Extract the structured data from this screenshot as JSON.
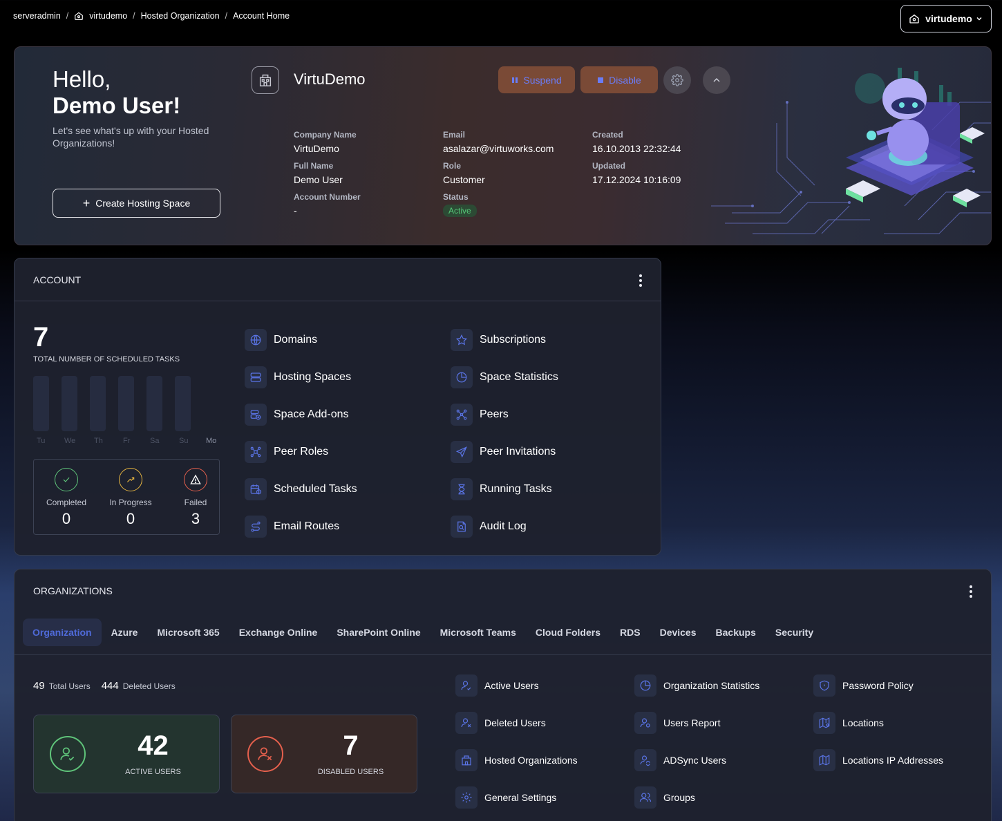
{
  "breadcrumb": {
    "items": [
      "serveradmin",
      "virtudemo",
      "Hosted Organization",
      "Account Home"
    ],
    "separator": "/"
  },
  "switcher": {
    "label": "virtudemo"
  },
  "hero": {
    "greeting_line1": "Hello,",
    "greeting_line2": "Demo User!",
    "subtitle": "Let's see what's up with your Hosted Organizations!",
    "create_button": "Create Hosting Space",
    "org_name": "VirtuDemo",
    "suspend_label": "Suspend",
    "disable_label": "Disable",
    "fields": {
      "company_name_label": "Company Name",
      "company_name": "VirtuDemo",
      "full_name_label": "Full Name",
      "full_name": "Demo User",
      "account_number_label": "Account Number",
      "account_number": "-",
      "email_label": "Email",
      "email": "asalazar@virtuworks.com",
      "role_label": "Role",
      "role": "Customer",
      "status_label": "Status",
      "status": "Active",
      "created_label": "Created",
      "created": "16.10.2013 22:32:44",
      "updated_label": "Updated",
      "updated": "17.12.2024 10:16:09"
    },
    "colors": {
      "button_bg": "#7a4a36",
      "button_text": "#6a7cf5",
      "status_green": "#55c978"
    }
  },
  "account": {
    "title": "ACCOUNT",
    "total_tasks": "7",
    "total_tasks_label": "TOTAL NUMBER OF SCHEDULED TASKS",
    "days": [
      "Tu",
      "We",
      "Th",
      "Fr",
      "Sa",
      "Su",
      "Mo"
    ],
    "stats": [
      {
        "label": "Completed",
        "value": "0",
        "icon": "check-icon",
        "color": "#5fc47a"
      },
      {
        "label": "In Progress",
        "value": "0",
        "icon": "trend-arrow-icon",
        "color": "#e3b341"
      },
      {
        "label": "Failed",
        "value": "3",
        "icon": "warning-icon",
        "color": "#e5604d"
      }
    ],
    "links": [
      {
        "label": "Domains",
        "icon": "globe-icon"
      },
      {
        "label": "Subscriptions",
        "icon": "star-icon"
      },
      {
        "label": "Hosting Spaces",
        "icon": "server-icon"
      },
      {
        "label": "Space Statistics",
        "icon": "pie-chart-icon"
      },
      {
        "label": "Space Add-ons",
        "icon": "addon-icon"
      },
      {
        "label": "Peers",
        "icon": "network-icon"
      },
      {
        "label": "Peer Roles",
        "icon": "peer-roles-icon"
      },
      {
        "label": "Peer Invitations",
        "icon": "send-icon"
      },
      {
        "label": "Scheduled Tasks",
        "icon": "calendar-clock-icon"
      },
      {
        "label": "Running Tasks",
        "icon": "hourglass-icon"
      },
      {
        "label": "Email Routes",
        "icon": "route-icon"
      },
      {
        "label": "Audit Log",
        "icon": "audit-icon"
      }
    ]
  },
  "organizations": {
    "title": "ORGANIZATIONS",
    "tabs": [
      "Organization",
      "Azure",
      "Microsoft 365",
      "Exchange Online",
      "SharePoint Online",
      "Microsoft Teams",
      "Cloud Folders",
      "RDS",
      "Devices",
      "Backups",
      "Security"
    ],
    "active_tab": "Organization",
    "total_users": "49",
    "total_users_label": "Total Users",
    "deleted_users": "444",
    "deleted_users_label": "Deleted Users",
    "active_users": "42",
    "active_users_label": "ACTIVE USERS",
    "disabled_users": "7",
    "disabled_users_label": "DISABLED USERS",
    "links": [
      {
        "label": "Active Users",
        "icon": "user-check-icon"
      },
      {
        "label": "Organization Statistics",
        "icon": "pie-chart-icon"
      },
      {
        "label": "Password Policy",
        "icon": "shield-icon"
      },
      {
        "label": "Deleted Users",
        "icon": "user-x-icon"
      },
      {
        "label": "Users Report",
        "icon": "user-report-icon"
      },
      {
        "label": "Locations",
        "icon": "map-pin-icon"
      },
      {
        "label": "Hosted Organizations",
        "icon": "building-icon"
      },
      {
        "label": "ADSync Users",
        "icon": "user-sync-icon"
      },
      {
        "label": "Locations IP Addresses",
        "icon": "map-ip-icon"
      },
      {
        "label": "General Settings",
        "icon": "gear-icon"
      },
      {
        "label": "Groups",
        "icon": "users-icon"
      }
    ]
  }
}
